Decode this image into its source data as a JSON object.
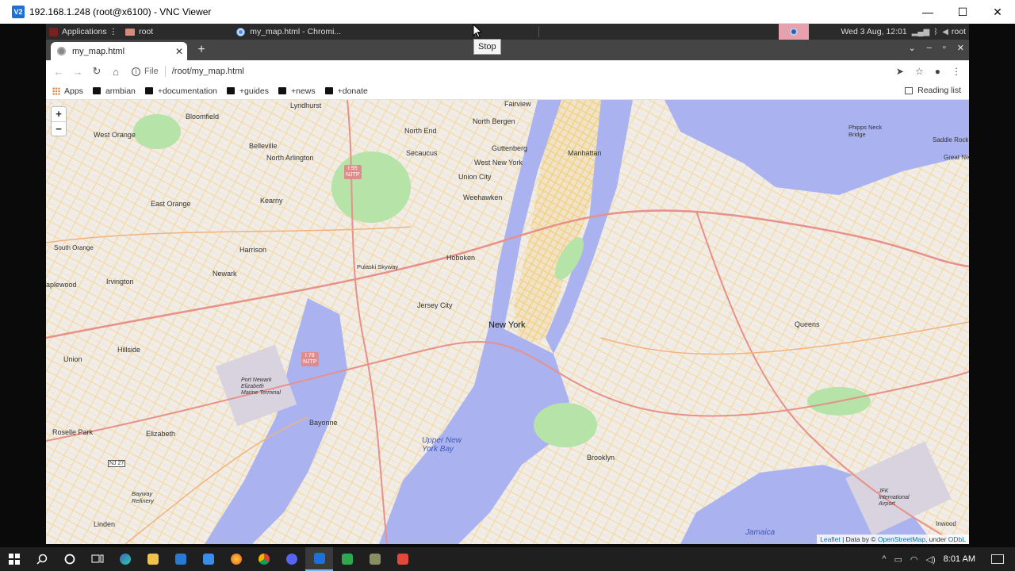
{
  "vnc": {
    "title": "192.168.1.248 (root@x6100) - VNC Viewer",
    "logo_text": "V2",
    "minimize": "—",
    "maximize": "☐",
    "close": "✕"
  },
  "panel": {
    "applications": "Applications",
    "applications_sep": "⋮",
    "folder": "root",
    "task_chromium": "my_map.html - Chromi...",
    "clock": "Wed  3 Aug, 12:01",
    "user": "root"
  },
  "tooltip": "Stop",
  "browser": {
    "tab_title": "my_map.html",
    "tab_close": "✕",
    "new_tab": "+",
    "back": "←",
    "forward": "→",
    "reload": "↻",
    "home": "⌂",
    "info": "i",
    "file_label": "File",
    "url": "/root/my_map.html",
    "bookmarks": [
      {
        "label": "Apps"
      },
      {
        "label": "armbian"
      },
      {
        "label": "+documentation"
      },
      {
        "label": "+guides"
      },
      {
        "label": "+news"
      },
      {
        "label": "+donate"
      }
    ],
    "reading_list": "Reading list"
  },
  "map": {
    "zoom_in": "+",
    "zoom_out": "−",
    "labels": {
      "lyndhurst": "Lyndhurst",
      "fairview": "Fairview",
      "bloomfield": "Bloomfield",
      "north_bergen": "North Bergen",
      "west_orange": "West Orange",
      "belleville": "Belleville",
      "north_end": "North End",
      "secaucus": "Secaucus",
      "guttenberg": "Guttenberg",
      "manhattan": "Manhattan",
      "north_arlington": "North Arlington",
      "west_new_york": "West New York",
      "union_city": "Union City",
      "kearny": "Kearny",
      "east_orange": "East Orange",
      "weehawken": "Weehawken",
      "south_orange": "South Orange",
      "harrison": "Harrison",
      "hoboken": "Hoboken",
      "newark": "Newark",
      "irvington": "Irvington",
      "maplewood": "aplewood",
      "jersey_city": "Jersey City",
      "new_york": "New York",
      "queens": "Queens",
      "hillside": "Hillside",
      "union": "Union",
      "roselle_park": "Roselle Park",
      "elizabeth": "Elizabeth",
      "bayonne": "Bayonne",
      "upper_bay": "Upper New York Bay",
      "brooklyn": "Brooklyn",
      "linden": "Linden",
      "jamaica": "Jamaica",
      "inwood": "Inwood",
      "saddle_rock": "Saddle Rock",
      "great_neck": "Great Nec",
      "phipps": "Phipps Neck Bridge",
      "bayway": "Bayway Refinery",
      "port_newark": "Port Newark Elizabeth Marine Terminal",
      "jfk": "JFK International Airport",
      "pulaski": "Pulaski Skyway",
      "nj27": "NJ 27"
    },
    "shields": {
      "i95": "I 95\nNJTP",
      "i78": "I 78\nNJTP"
    },
    "attribution": {
      "leaflet": "Leaflet",
      "pipe": " | Data by © ",
      "osm": "OpenStreetMap",
      "under": ", under ",
      "odbl": "ODbL"
    }
  },
  "taskbar": {
    "clock": "8:01 AM",
    "chevron": "^"
  }
}
